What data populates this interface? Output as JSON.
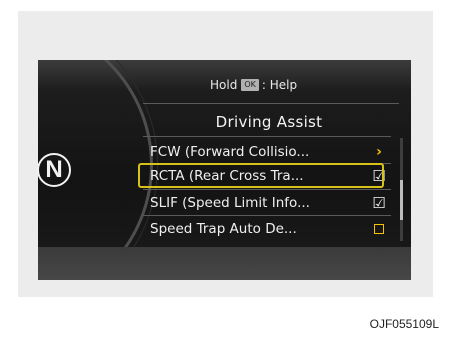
{
  "header": {
    "hold_text": "Hold",
    "ok_key": "OK",
    "help_text": ": Help"
  },
  "title": "Driving Assist",
  "gear": "N",
  "menu": {
    "items": [
      {
        "label": "FCW (Forward Collisio...",
        "indicator": "chevron-right-icon",
        "indicator_glyph": "›"
      },
      {
        "label": "RCTA (Rear Cross Tra...",
        "indicator": "checkbox-checked-icon",
        "indicator_glyph": "☑",
        "highlighted": true
      },
      {
        "label": "SLIF (Speed Limit Info...",
        "indicator": "checkbox-checked-icon",
        "indicator_glyph": "☑"
      },
      {
        "label": "Speed Trap Auto De...",
        "indicator": "checkbox-empty-icon",
        "indicator_glyph": ""
      }
    ]
  },
  "caption": "OJF055109L",
  "colors": {
    "highlight_border": "#d7c11b",
    "accent_yellow": "#f5c400",
    "screen_bg": "#131313"
  }
}
